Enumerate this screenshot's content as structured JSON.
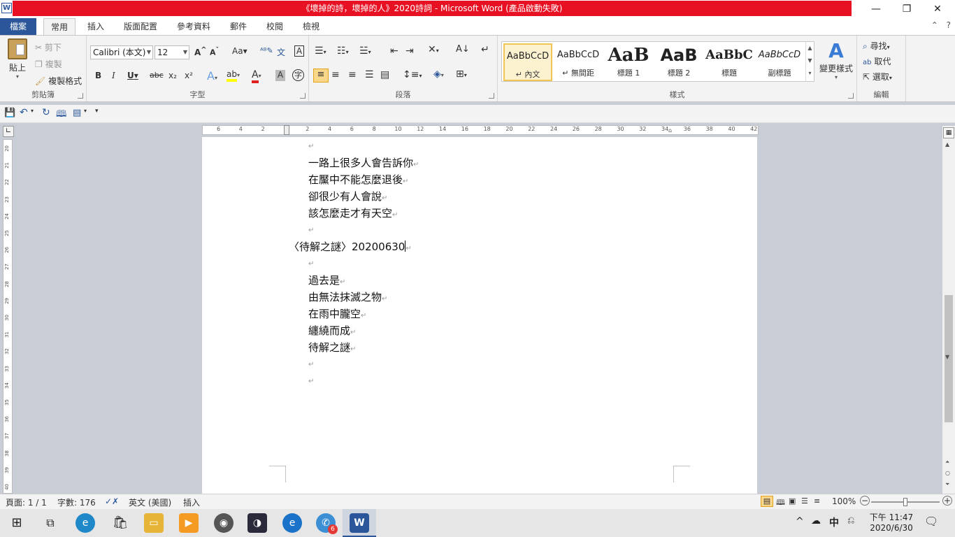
{
  "window": {
    "title": "《壞掉的詩，壞掉的人》2020詩詞 - Microsoft Word (產品啟動失敗)",
    "app_icon": "W",
    "minimize": "—",
    "maximize": "❐",
    "close": "✕"
  },
  "tabs": [
    "檔案",
    "常用",
    "插入",
    "版面配置",
    "參考資料",
    "郵件",
    "校閱",
    "檢視"
  ],
  "ribbon": {
    "clipboard": {
      "paste": "貼上",
      "cut": "剪下",
      "copy": "複製",
      "format_painter": "複製格式",
      "label": "剪貼簿"
    },
    "font": {
      "name": "Calibri (本文)",
      "size": "12",
      "label": "字型",
      "case": "Aa",
      "bold": "B",
      "italic": "I",
      "underline": "U",
      "strike": "abc",
      "sub": "x₂",
      "sup": "x²"
    },
    "paragraph": {
      "label": "段落"
    },
    "styles": {
      "items": [
        {
          "sample": "AaBbCcD",
          "name": "↵ 內文"
        },
        {
          "sample": "AaBbCcD",
          "name": "↵ 無間距"
        },
        {
          "sample": "AaB",
          "name": "標題 1"
        },
        {
          "sample": "AaB",
          "name": "標題 2"
        },
        {
          "sample": "AaBbC",
          "name": "標題"
        },
        {
          "sample": "AaBbCcD",
          "name": "副標題"
        }
      ],
      "change_styles": "變更樣式",
      "label": "樣式"
    },
    "editing": {
      "find": "尋找",
      "replace": "取代",
      "select": "選取",
      "label": "編輯"
    }
  },
  "ruler": {
    "h_labels": [
      "6",
      "4",
      "2",
      "",
      "2",
      "4",
      "6",
      "8",
      "10",
      "12",
      "14",
      "16",
      "18",
      "20",
      "22",
      "24",
      "26",
      "28",
      "30",
      "32",
      "34",
      "36",
      "38",
      "40",
      "42"
    ],
    "v_labels": [
      "20",
      "21",
      "22",
      "23",
      "24",
      "25",
      "26",
      "27",
      "28",
      "29",
      "30",
      "31",
      "32",
      "33",
      "34",
      "35",
      "36",
      "37",
      "38",
      "39",
      "40"
    ]
  },
  "document": {
    "lines": [
      {
        "text": "",
        "indent": true
      },
      {
        "text": "一路上很多人會告訴你",
        "indent": true
      },
      {
        "text": "在黶中不能怎麼退後",
        "indent": true
      },
      {
        "text": "卻很少有人會說",
        "indent": true
      },
      {
        "text": "該怎麼走才有天空",
        "indent": true
      },
      {
        "text": "",
        "indent": true
      },
      {
        "text": "〈待解之謎〉20200630",
        "indent": false,
        "cursor": true
      },
      {
        "text": "",
        "indent": true
      },
      {
        "text": "過去是",
        "indent": true
      },
      {
        "text": "由無法抹滅之物",
        "indent": true
      },
      {
        "text": "在雨中朧空",
        "indent": true
      },
      {
        "text": "纏繞而成",
        "indent": true
      },
      {
        "text": "待解之謎",
        "indent": true
      },
      {
        "text": "",
        "indent": true
      },
      {
        "text": "",
        "indent": true
      }
    ],
    "para_mark": "↵"
  },
  "status": {
    "page": "頁面: 1 / 1",
    "words": "字數: 176",
    "language": "英文 (美國)",
    "mode": "插入",
    "zoom": "100%",
    "zoom_minus": "−",
    "zoom_plus": "+"
  },
  "taskbar": {
    "ime": "中",
    "time": "下午 11:47",
    "date": "2020/6/30",
    "badge": "6"
  },
  "colors": {
    "accent": "#2b579a",
    "title_bg": "#e81123"
  }
}
